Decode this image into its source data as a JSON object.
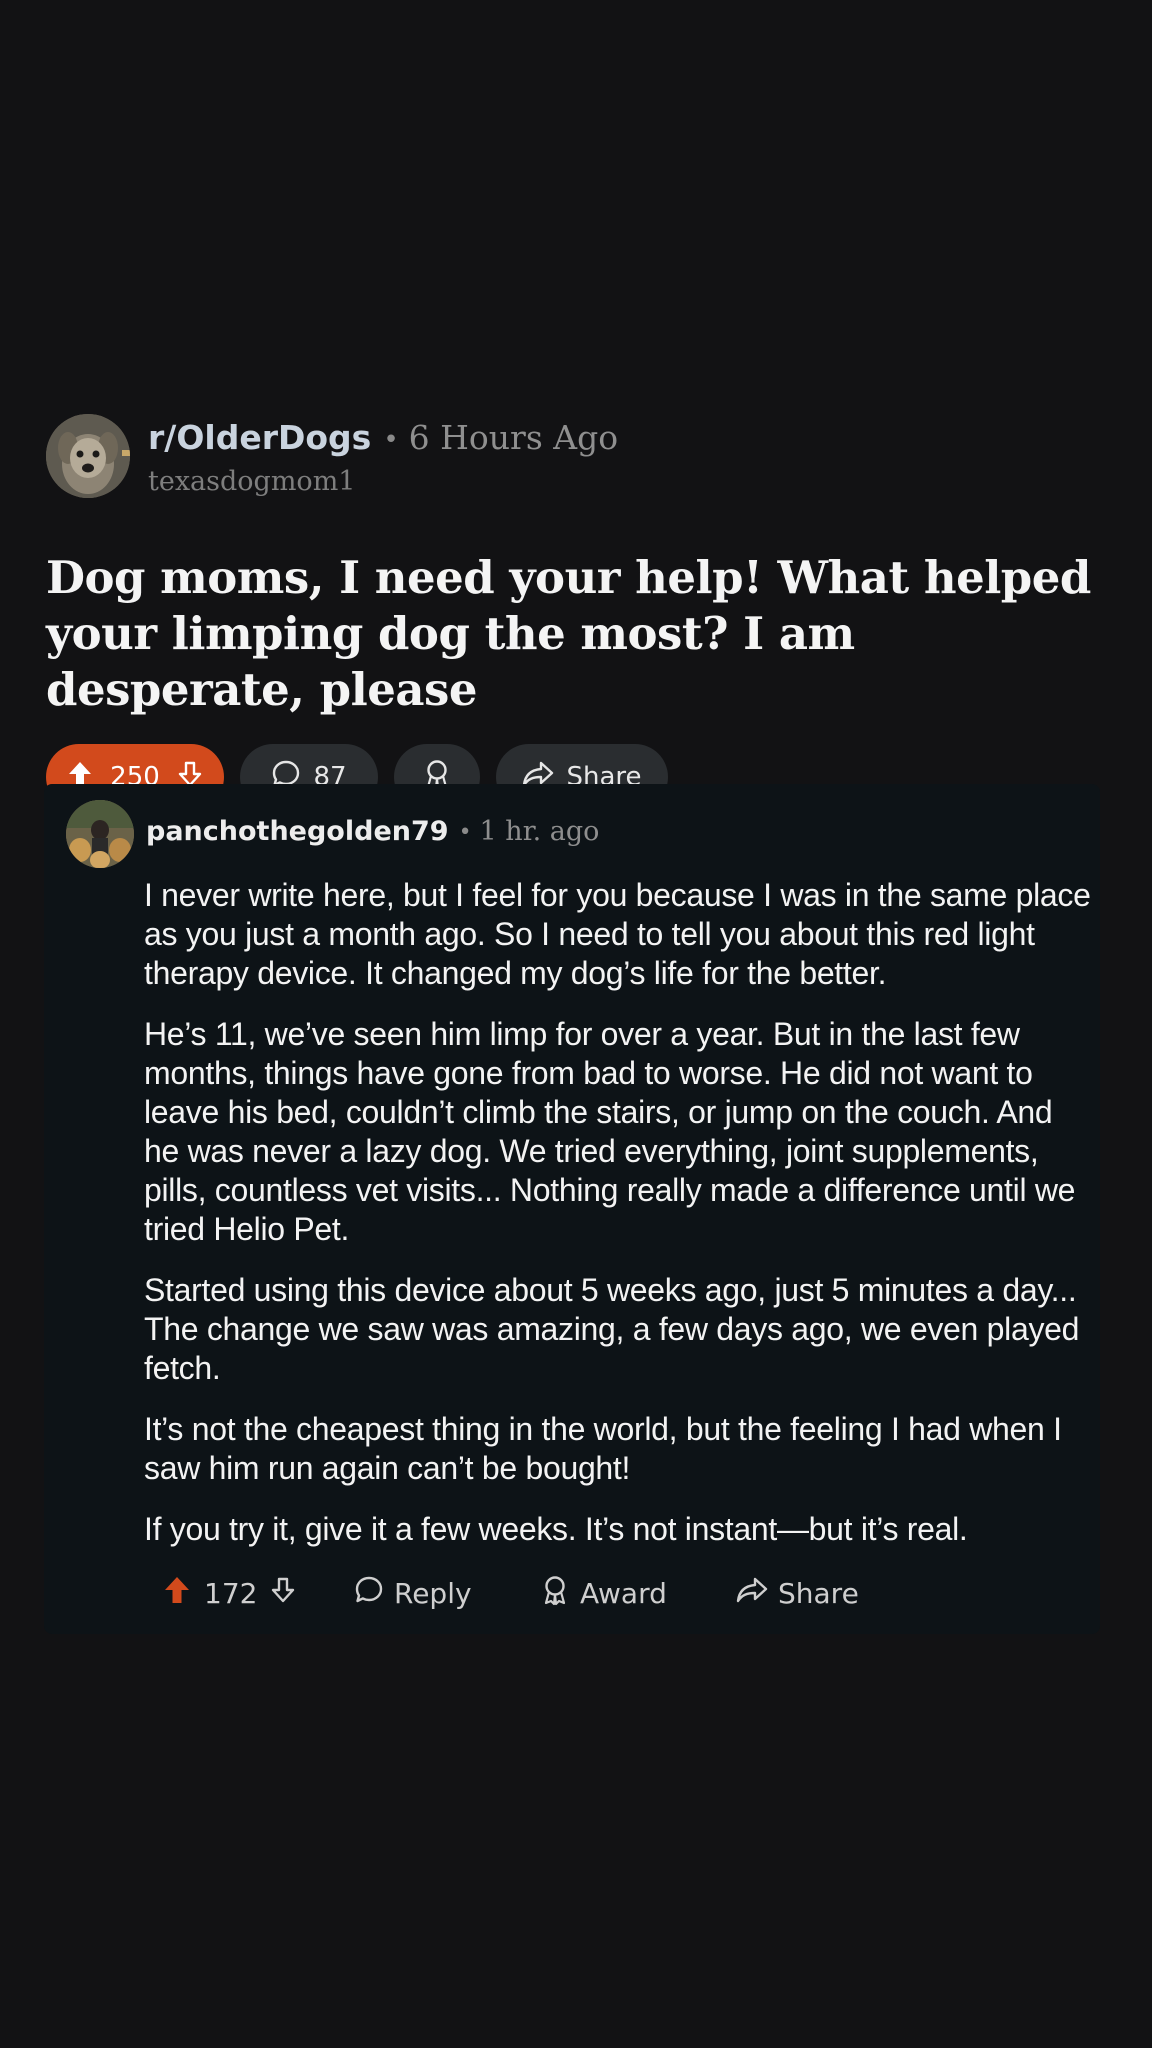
{
  "post": {
    "subreddit": "r/OlderDogs",
    "separator": "•",
    "time": "6 Hours Ago",
    "author": "texasdogmom1",
    "title": "Dog moms, I need your help! What helped your limping dog the most? I am desperate, please",
    "votes": "250",
    "comments": "87",
    "share_label": "Share"
  },
  "comment": {
    "username": "panchothegolden79",
    "separator": "•",
    "time": "1 hr. ago",
    "paragraphs": [
      "I never write here, but I feel for you because I was in the same place as you just a month ago. So I need to tell you about this red light therapy device. It changed my dog’s life for the better.",
      "He’s 11, we’ve seen him limp for over a year. But in the last few months, things have gone from bad to worse. He did not want to leave his bed, couldn’t climb the stairs, or jump on the couch. And he was never a lazy dog. We tried everything, joint supplements, pills, countless vet visits... Nothing really made a difference until we tried Helio Pet.",
      "Started using this device about 5 weeks ago, just 5 minutes a day... The change we saw was amazing, a few days ago, we even played fetch.",
      "It’s not the cheapest thing in the world, but the feeling I had when I saw him run again can’t be bought!",
      "If you try it, give it a few weeks. It’s not instant—but it’s real."
    ],
    "votes": "172",
    "reply_label": "Reply",
    "award_label": "Award",
    "share_label": "Share"
  },
  "colors": {
    "background": "#121214",
    "upvote_accent": "#d24a1c",
    "pill_background": "#2a2d30",
    "comment_background": "#0d1317"
  },
  "icons": {
    "upvote": "arrow-up-icon",
    "downvote": "arrow-down-icon",
    "comment": "speech-bubble-icon",
    "award": "award-ribbon-icon",
    "share": "share-arrow-icon"
  }
}
